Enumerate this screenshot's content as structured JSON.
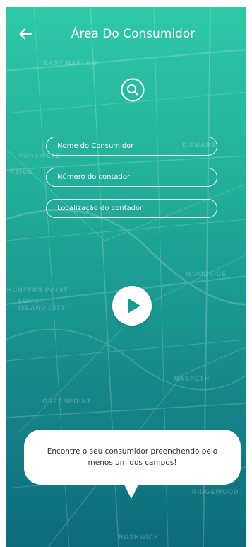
{
  "header": {
    "title": "Área Do Consumidor",
    "back_icon": "arrow-left-icon"
  },
  "search": {
    "icon": "search-icon"
  },
  "form": {
    "consumer_name_placeholder": "Nome do Consumidor",
    "meter_number_placeholder": "Número do contador",
    "meter_location_placeholder": "Localização do contador"
  },
  "submit": {
    "icon": "play-icon"
  },
  "tooltip": {
    "text": "Encontre o seu consumidor preenchendo pelo menos um dos campos!"
  },
  "map_labels": [
    "EAST HARLEM",
    "YORKVILLE",
    "RSIDE",
    "DITMARS",
    "WOODSIDE",
    "HUNTERS POINT",
    "LONG ISLAND CITY",
    "MASPETH",
    "GREENPOINT",
    "RIDGEWOOD",
    "BUSHWICK"
  ],
  "colors": {
    "gradient_top": "#2ec9a6",
    "gradient_bottom": "#0e6b7c",
    "foreground": "#ffffff",
    "tooltip_text": "#333333"
  }
}
